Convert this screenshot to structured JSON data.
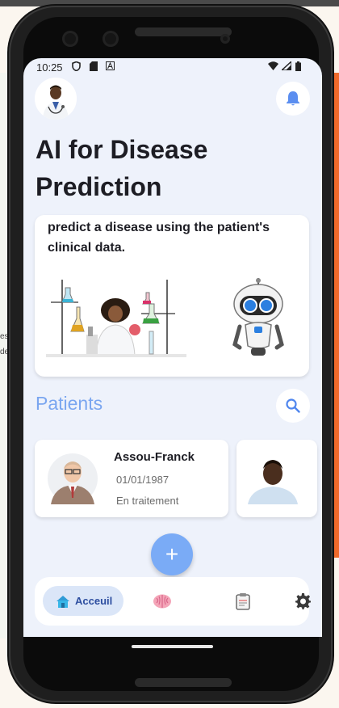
{
  "status_bar": {
    "time": "10:25",
    "icons": [
      "shield-icon",
      "sim-card-icon",
      "font-a-icon",
      "wifi-icon",
      "signal-icon",
      "battery-icon"
    ]
  },
  "header": {
    "title": "AI for Disease Prediction",
    "avatar": "doctor-avatar",
    "notification_icon": "bell-icon"
  },
  "intro_card": {
    "text": "predict a disease using the patient's clinical data.",
    "illustrations": [
      "lab-scientist-illustration",
      "robot-illustration"
    ]
  },
  "patients": {
    "title": "Patients",
    "search_icon": "search-icon",
    "list": [
      {
        "name": "Assou-Franck",
        "birth_date": "01/01/1987",
        "status": "En traitement"
      },
      {
        "name": "",
        "birth_date": "",
        "status": ""
      }
    ]
  },
  "fab": {
    "label": "+"
  },
  "bottom_nav": {
    "items": [
      {
        "label": "Acceuil",
        "icon": "home-icon",
        "active": true
      },
      {
        "label": "",
        "icon": "brain-icon",
        "active": false
      },
      {
        "label": "",
        "icon": "clipboard-icon",
        "active": false
      },
      {
        "label": "",
        "icon": "settings-gear-icon",
        "active": false
      }
    ]
  },
  "colors": {
    "screen_bg": "#eef2fb",
    "accent": "#7aa6f0",
    "fab": "#7aabf6",
    "nav_active_bg": "#dbe6f8",
    "nav_active_text": "#2d4ea0",
    "title_text": "#1d1d24",
    "secondary_text": "#6b6b6b"
  }
}
